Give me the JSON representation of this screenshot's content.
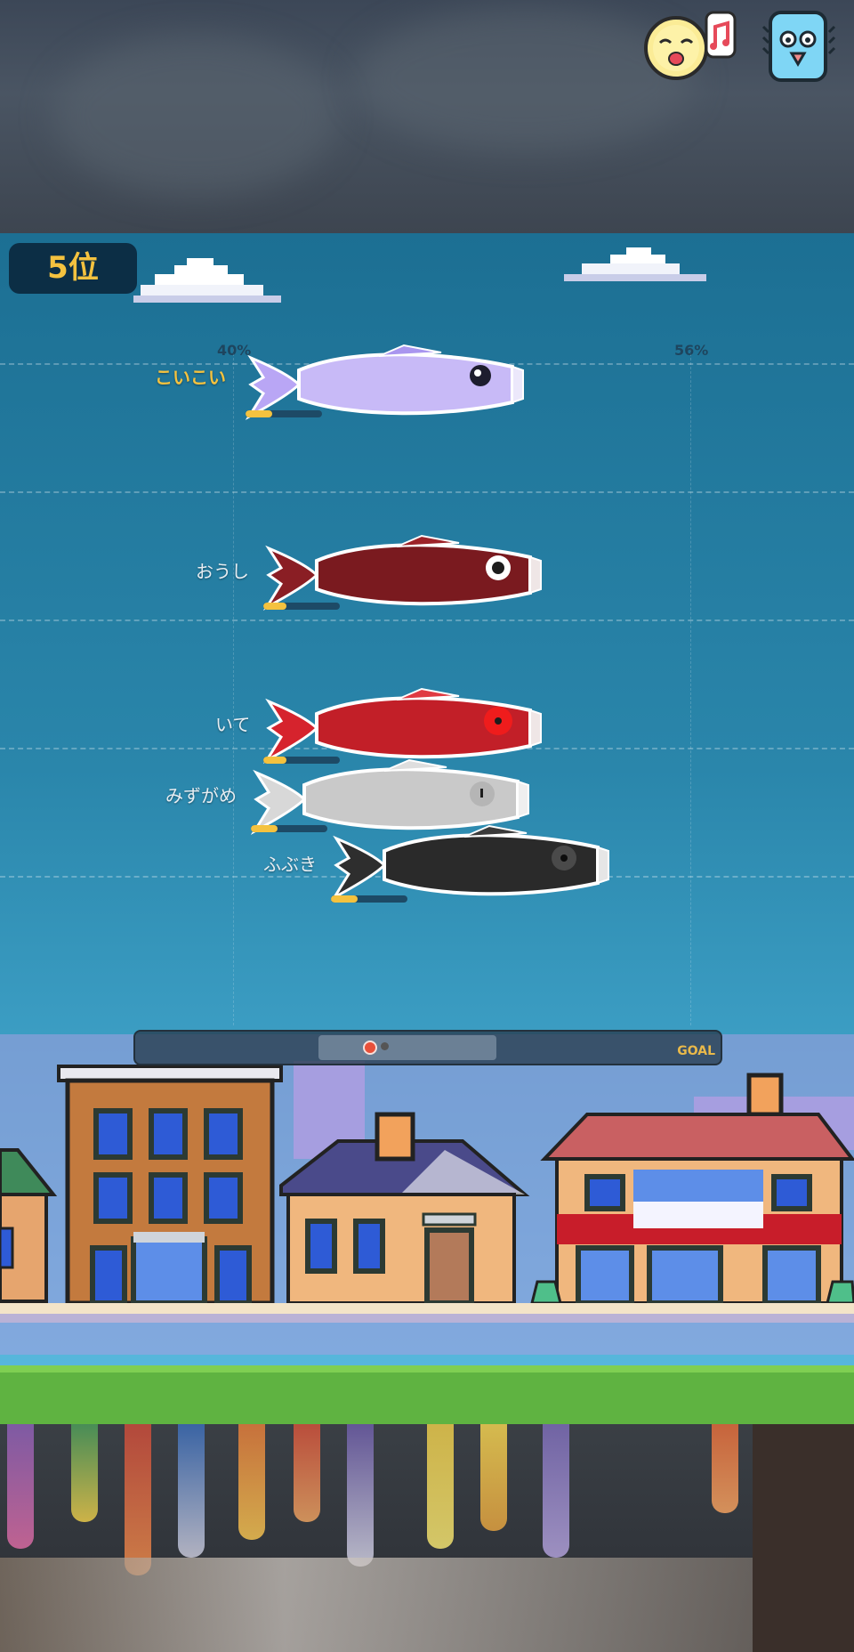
{
  "header": {
    "mood_icon": "singing-face-icon",
    "menu_icon": "blue-fish-face-icon"
  },
  "race": {
    "rank": "5位",
    "pct_left": "40%",
    "pct_right": "56%",
    "goal_label": "GOAL"
  },
  "koi": [
    {
      "name": "こいこい",
      "color": "purple",
      "stamina": 0.35,
      "is_player": true
    },
    {
      "name": "おうし",
      "color": "dark-red",
      "stamina": 0.3,
      "is_player": false
    },
    {
      "name": "いて",
      "color": "red",
      "stamina": 0.3,
      "is_player": false
    },
    {
      "name": "みずがめ",
      "color": "white",
      "stamina": 0.35,
      "is_player": false
    },
    {
      "name": "ふぶき",
      "color": "black",
      "stamina": 0.35,
      "is_player": false
    }
  ],
  "progress": {
    "player_marker_color": "#e8503a",
    "other_marker_color": "#555555"
  },
  "colors": {
    "accent": "#f4c23f"
  }
}
